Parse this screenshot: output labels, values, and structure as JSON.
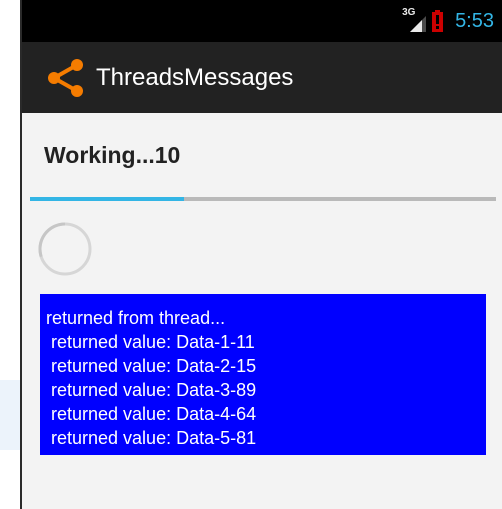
{
  "status_bar": {
    "network_label": "3G",
    "clock": "5:53",
    "icons": [
      "signal-3g-icon",
      "battery-alert-icon"
    ]
  },
  "action_bar": {
    "icon": "share-icon",
    "title": "ThreadsMessages"
  },
  "main": {
    "working_text": "Working...10",
    "progress_fraction": 0.33,
    "spinner": "loading-spinner",
    "output_lines": [
      "returned from thread...",
      " returned value: Data-1-11",
      " returned value: Data-2-15",
      " returned value: Data-3-89",
      " returned value: Data-4-64",
      " returned value: Data-5-81"
    ]
  },
  "colors": {
    "accent": "#33b5e5",
    "action_bar": "#222222",
    "output_bg": "#0000ff",
    "app_icon": "#f57c00",
    "battery_alert": "#cc0000"
  }
}
